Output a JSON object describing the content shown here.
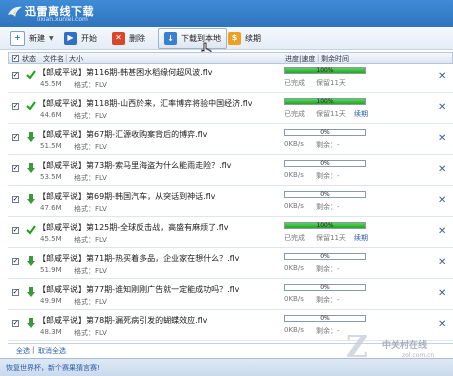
{
  "app": {
    "title": "迅雷离线下载",
    "subtitle": "lixian.xunlei.com"
  },
  "toolbar": {
    "new_label": "新建",
    "start_label": "开始",
    "delete_label": "删除",
    "download_local_label": "下载到本地",
    "renew_label": "续期"
  },
  "columns": {
    "status": "状态",
    "filename": "文件名",
    "size": "大小",
    "progress_speed": "进度|速度",
    "remaining": "剩余时间"
  },
  "rows": [
    {
      "name": "【郎咸平说】第116期-韩甚困水稻缘何超风波.flv",
      "size": "45.5M",
      "format": "格式：FLV",
      "state": "done",
      "progress": 100,
      "pct": "100%",
      "speed": "已完成",
      "remain": "保留11天",
      "extra": ""
    },
    {
      "name": "【郎咸平说】第118期-山西於来，汇率博弈将验中国经济.flv",
      "size": "44.6M",
      "format": "格式：FLV",
      "state": "done",
      "progress": 100,
      "pct": "100%",
      "speed": "已完成",
      "remain": "保留11天",
      "extra": "续期"
    },
    {
      "name": "【郎咸平说】第67期-汇源收购案背后的博弈.flv",
      "size": "51.5M",
      "format": "格式：FLV",
      "state": "queued",
      "progress": 0,
      "pct": "0%",
      "speed": "0KB/s",
      "remain": "剩余：-",
      "extra": ""
    },
    {
      "name": "【郎咸平说】第73期-索马里海盗为什么能雨走险？.flv",
      "size": "53.5M",
      "format": "格式：FLV",
      "state": "queued",
      "progress": 0,
      "pct": "0%",
      "speed": "0KB/s",
      "remain": "剩余：-",
      "extra": ""
    },
    {
      "name": "【郎咸平说】第69期-韩国汽车，从突话到神话.flv",
      "size": "47.6M",
      "format": "格式：FLV",
      "state": "queued",
      "progress": 0,
      "pct": "0%",
      "speed": "0KB/s",
      "remain": "剩余：-",
      "extra": ""
    },
    {
      "name": "【郎咸平说】第125期-全球反击战，高盛有麻烦了.flv",
      "size": "45.5M",
      "format": "格式：FLV",
      "state": "done",
      "progress": 100,
      "pct": "100%",
      "speed": "已完成",
      "remain": "保留11天",
      "extra": "续期"
    },
    {
      "name": "【郎咸平说】第71期-热买着多品，企业家在想什么？.flv",
      "size": "51.9M",
      "format": "格式：FLV",
      "state": "queued",
      "progress": 0,
      "pct": "0%",
      "speed": "0KB/s",
      "remain": "剩余：-",
      "extra": ""
    },
    {
      "name": "【郎咸平说】第77期-谁知刚刚广告就一定能成功吗？.flv",
      "size": "49.9M",
      "format": "格式：FLV",
      "state": "queued",
      "progress": 0,
      "pct": "0%",
      "speed": "0KB/s",
      "remain": "剩余：-",
      "extra": ""
    },
    {
      "name": "【郎咸平说】第78期-漏死病引发的蝴蝶效应.flv",
      "size": "48.3M",
      "format": "格式：FLV",
      "state": "queued",
      "progress": 0,
      "pct": "0%",
      "speed": "0KB/s",
      "remain": "剩余：-",
      "extra": ""
    }
  ],
  "footer": {
    "select_all": "全选",
    "deselect_all": "取消全选",
    "status_message": "恢复世界杯，新个赛果猜言赛!"
  },
  "watermark": {
    "text": "中关村在线",
    "url": "zol.com.cn",
    "z": "Z"
  },
  "colors": {
    "header": "#2f74bd",
    "progress_fill": "#1fa91f",
    "done_check": "#1aa31a",
    "queued_arrow": "#3a9a3a"
  }
}
